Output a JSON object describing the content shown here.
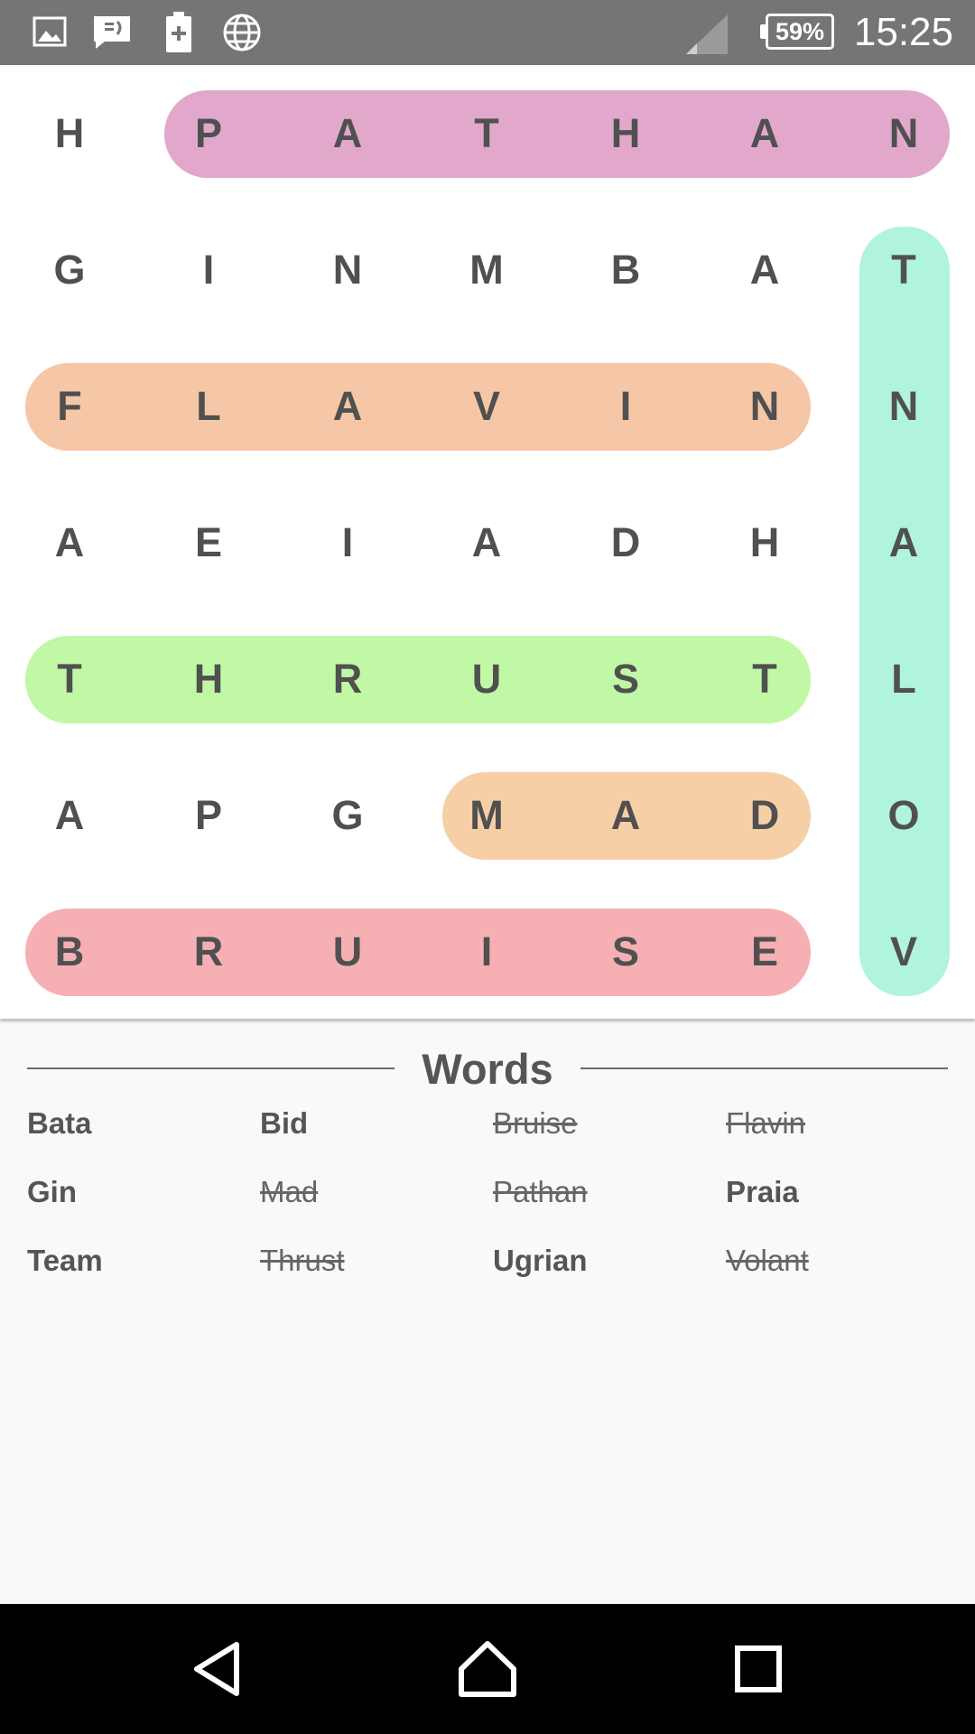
{
  "status_bar": {
    "time": "15:25",
    "battery_percent": "59%",
    "icons": [
      "image-icon",
      "message-icon",
      "battery-saver-icon",
      "globe-icon",
      "signal-icon"
    ]
  },
  "grid": {
    "rows": [
      [
        "H",
        "P",
        "A",
        "T",
        "H",
        "A",
        "N"
      ],
      [
        "G",
        "I",
        "N",
        "M",
        "B",
        "A",
        "T"
      ],
      [
        "F",
        "L",
        "A",
        "V",
        "I",
        "N",
        "N"
      ],
      [
        "A",
        "E",
        "I",
        "A",
        "D",
        "H",
        "A"
      ],
      [
        "T",
        "H",
        "R",
        "U",
        "S",
        "T",
        "L"
      ],
      [
        "A",
        "P",
        "G",
        "M",
        "A",
        "D",
        "O"
      ],
      [
        "B",
        "R",
        "U",
        "I",
        "S",
        "E",
        "V"
      ]
    ],
    "found_highlights": [
      {
        "word": "PATHAN",
        "color": "#e2a8cb"
      },
      {
        "word": "VOLANT",
        "color": "#b0f3de"
      },
      {
        "word": "FLAVIN",
        "color": "#f6c7a6"
      },
      {
        "word": "THRUST",
        "color": "#c0f8a5"
      },
      {
        "word": "MAD",
        "color": "#f6cfa6"
      },
      {
        "word": "BRUISE",
        "color": "#f6b0b3"
      }
    ]
  },
  "words_panel": {
    "title": "Words",
    "words": [
      {
        "text": "Bata",
        "found": false
      },
      {
        "text": "Bid",
        "found": false
      },
      {
        "text": "Bruise",
        "found": true
      },
      {
        "text": "Flavin",
        "found": true
      },
      {
        "text": "Gin",
        "found": false
      },
      {
        "text": "Mad",
        "found": true
      },
      {
        "text": "Pathan",
        "found": true
      },
      {
        "text": "Praia",
        "found": false
      },
      {
        "text": "Team",
        "found": false
      },
      {
        "text": "Thrust",
        "found": true
      },
      {
        "text": "Ugrian",
        "found": false
      },
      {
        "text": "Volant",
        "found": true
      }
    ]
  },
  "nav_bar": {
    "buttons": [
      "back-icon",
      "home-icon",
      "recents-icon"
    ]
  }
}
